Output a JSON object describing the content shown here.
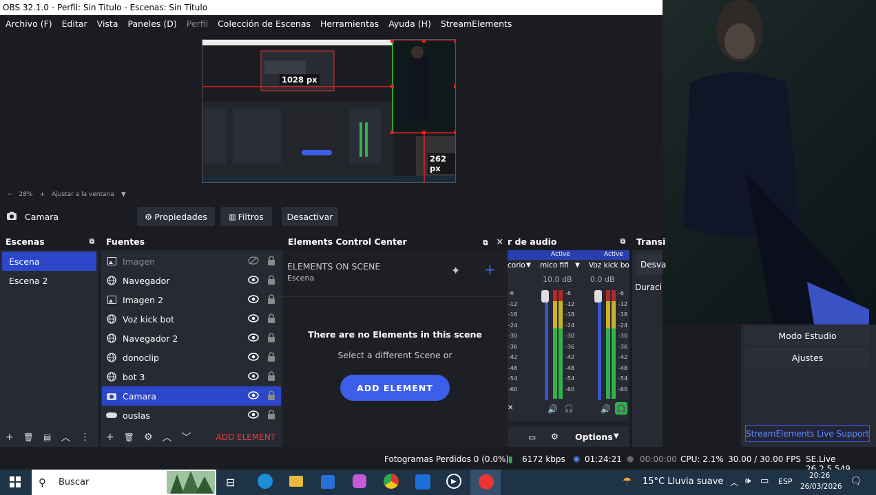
{
  "window": {
    "title": "OBS 32.1.0 - Perfil: Sin Titulo - Escenas: Sin Titulo"
  },
  "menu": [
    {
      "label": "Archivo (F)",
      "enabled": true
    },
    {
      "label": "Editar",
      "enabled": true
    },
    {
      "label": "Vista",
      "enabled": true
    },
    {
      "label": "Paneles (D)",
      "enabled": true
    },
    {
      "label": "Perfil",
      "enabled": false
    },
    {
      "label": "Colección de Escenas",
      "enabled": true
    },
    {
      "label": "Herramientas",
      "enabled": true
    },
    {
      "label": "Ayuda (H)",
      "enabled": true
    },
    {
      "label": "StreamElements",
      "enabled": true
    }
  ],
  "preview": {
    "width_label": "1028 px",
    "height_label": "262 px",
    "zoom": "28%",
    "fit_label": "Ajustar a la ventana"
  },
  "source_toolbar": {
    "source_name": "Camara",
    "properties": "Propiedades",
    "filters": "Filtros",
    "deactivate": "Desactivar"
  },
  "scenes": {
    "title": "Escenas",
    "items": [
      {
        "label": "Escena",
        "selected": true
      },
      {
        "label": "Escena 2",
        "selected": false
      }
    ]
  },
  "sources": {
    "title": "Fuentes",
    "items": [
      {
        "label": "Imagen",
        "icon": "image-icon",
        "visible": false,
        "selected": false
      },
      {
        "label": "Navegador",
        "icon": "globe-icon",
        "visible": true,
        "selected": false
      },
      {
        "label": "Imagen 2",
        "icon": "image-icon",
        "visible": true,
        "selected": false
      },
      {
        "label": "Voz kick bot",
        "icon": "globe-icon",
        "visible": true,
        "selected": false
      },
      {
        "label": "Navegador 2",
        "icon": "globe-icon",
        "visible": true,
        "selected": false
      },
      {
        "label": "donoclip",
        "icon": "globe-icon",
        "visible": true,
        "selected": false
      },
      {
        "label": "bot 3",
        "icon": "globe-icon",
        "visible": true,
        "selected": false
      },
      {
        "label": "Camara",
        "icon": "camera-icon",
        "visible": true,
        "selected": true
      },
      {
        "label": "ousIas",
        "icon": "gamepad-icon",
        "visible": true,
        "selected": false
      }
    ],
    "add_element": "ADD ELEMENT"
  },
  "elements": {
    "title": "Elements Control Center",
    "heading": "ELEMENTS ON SCENE",
    "scene": "Escena",
    "empty_title": "There are no Elements in this scene",
    "empty_sub": "Select a different Scene or",
    "button": "ADD ELEMENT"
  },
  "audio": {
    "title": "r de audio",
    "channels": [
      {
        "name": "corio",
        "db": "",
        "status": "Active"
      },
      {
        "name": "mico fifl",
        "db": "10.0 dB",
        "status": "Active"
      },
      {
        "name": "Voz kick bo",
        "db": "0.0 dB",
        "status": ""
      }
    ],
    "ticks": [
      "-6",
      "-12",
      "-18",
      "-24",
      "-30",
      "-36",
      "-42",
      "-48",
      "-54",
      "-60"
    ],
    "options": "Options"
  },
  "transitions": {
    "title": "Transi",
    "mode": "Desva",
    "duration": "Duraci"
  },
  "controls": {
    "studio": "Modo Estudio",
    "settings": "Ajustes",
    "support": "StreamElements Live Support"
  },
  "status": {
    "dropped": "Fotogramas Perdidos 0 (0.0%)",
    "bitrate": "6172 kbps",
    "stream_time": "01:24:21",
    "rec_time": "00:00:00",
    "cpu": "CPU: 2.1%",
    "fps": "30.00 / 30.00 FPS",
    "se_version": "SE.Live 26.2.5.549"
  },
  "taskbar": {
    "search": "Buscar",
    "weather": "15°C  Lluvia suave",
    "lang": "ESP",
    "time": "20:26",
    "date": "26/03/2026"
  },
  "colors": {
    "accent": "#2b46c8",
    "se_button": "#3c5ee8",
    "meter_green": "#2fb24a",
    "meter_yellow": "#c9b22a",
    "meter_red": "#b62727"
  }
}
